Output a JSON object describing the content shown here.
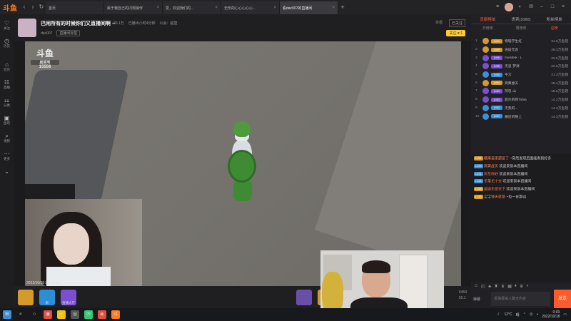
{
  "app": {
    "logo_text": "斗鱼"
  },
  "titlebar": {
    "tabs": [
      {
        "label": "首页"
      },
      {
        "label": "属于我自己的闪现操作"
      },
      {
        "label": "爱，欢迎我们的..."
      },
      {
        "label": "无形的心心心心心..."
      },
      {
        "label": "看dac007的直播间",
        "active": true
      }
    ]
  },
  "leftnav": [
    {
      "icon": "♡",
      "label": "关注"
    },
    {
      "icon": "◷",
      "label": "历史"
    },
    {
      "icon": "⌂",
      "label": "首页"
    },
    {
      "icon": "☷",
      "label": "直播"
    },
    {
      "icon": "⚏",
      "label": "分类"
    },
    {
      "icon": "▣",
      "label": "鱼吧"
    },
    {
      "icon": "⌕",
      "label": "视频"
    },
    {
      "icon": "⋯",
      "label": "更多"
    }
  ],
  "room": {
    "title": "巴闲所有的时候你们又直播间啊 ~",
    "host": "dac007",
    "tag_btn": "直播间标签",
    "hot": "30.1万",
    "stat2": "已播出小时4分钟",
    "stat3": "公会：超皇",
    "report": "举报",
    "mute_btn": "已关注",
    "follow_btn": "关注 ♥ 1"
  },
  "watermark": {
    "logo": "斗鱼",
    "room_label": "房间号",
    "room_no": "15556"
  },
  "cam_left": {
    "timestamp": "2022/10/18 23:10:18"
  },
  "player_bar": {
    "gifts": [
      {
        "label": ""
      },
      {
        "label": "新"
      },
      {
        "label": "直播大厅"
      }
    ],
    "right_line1": "6459",
    "right_line2": "50.1"
  },
  "rightpanel": {
    "tabs": [
      {
        "label": "贡献榜单",
        "active": true
      },
      {
        "label": "贵宾(1060)"
      },
      {
        "label": "粉丝榜单"
      }
    ],
    "subtabs": [
      {
        "label": "日榜单"
      },
      {
        "label": "周榜单"
      },
      {
        "label": "总榜",
        "active": true
      }
    ],
    "ranks": [
      {
        "n": "1",
        "name": "物理学生虹",
        "val": "31.5万鱼翅",
        "lv": "LV41",
        "col": "#d49b2c"
      },
      {
        "n": "2",
        "name": "逍遥无忌",
        "val": "28.3万鱼翅",
        "lv": "LV39",
        "col": "#d49b2c"
      },
      {
        "n": "3",
        "name": "Invisible · L",
        "val": "22.5万鱼翅",
        "lv": "LV38",
        "col": "#7a4fd1"
      },
      {
        "n": "4",
        "name": "无忌·梦清",
        "val": "22.6万鱼翅",
        "lv": "LV35",
        "col": "#7a4fd1"
      },
      {
        "n": "5",
        "name": "牛刀",
        "val": "21.3万鱼翅",
        "lv": "LV35",
        "col": "#3c8fd6"
      },
      {
        "n": "6",
        "name": "冥黄虚天",
        "val": "15.4万鱼翅",
        "lv": "LV34",
        "col": "#d49b2c"
      },
      {
        "n": "7",
        "name": "阿忠·山",
        "val": "15.0万鱼翅",
        "lv": "LV33",
        "col": "#7a4fd1"
      },
      {
        "n": "8",
        "name": "超冰的我Tobia",
        "val": "14.2万鱼翅",
        "lv": "LV33",
        "col": "#7a4fd1"
      },
      {
        "n": "9",
        "name": "无我的...",
        "val": "14.3万鱼翅",
        "lv": "LV32",
        "col": "#3c8fd6"
      },
      {
        "n": "10",
        "name": "最后的晚上",
        "val": "14.3万鱼翅",
        "lv": "LV31",
        "col": "#3c8fd6"
      }
    ],
    "chat": [
      {
        "badge": "LV31",
        "bcol": "#d49b2c",
        "user": "糖果皇家超爱了",
        "text": "~突然发现后面能看到好多"
      },
      {
        "badge": "LV29",
        "bcol": "#3c8fd6",
        "user": "冥黄虚天",
        "text": "欢迎来到本直播间"
      },
      {
        "badge": "LV31",
        "bcol": "#3c8fd6",
        "user": "灰灰你好",
        "text": "欢迎来到本直播间"
      },
      {
        "badge": "LV28",
        "bcol": "#3c8fd6",
        "user": "冬菜尤十夫",
        "text": "欢迎来到本直播间"
      },
      {
        "badge": "LV25",
        "bcol": "#d49b2c",
        "user": "逍遥无忌天下",
        "text": "欢迎来到本直播间"
      },
      {
        "badge": "LV33",
        "bcol": "#d49b2c",
        "user": "宝宝钟天就是",
        "text": "~拉一在那边"
      }
    ],
    "chat_tools": [
      "☺",
      "◰",
      "◈",
      "♜",
      "♛",
      "▦",
      "♦",
      "♛",
      "◐"
    ],
    "input_placeholder": "发弹幕输入聊天内容",
    "input_side": "弹幕",
    "send": "发送"
  },
  "taskbar": {
    "icons": [
      "⊞",
      "⌕",
      "○",
      "◉",
      "◐",
      "◎",
      "✉",
      "◈",
      "斗"
    ],
    "temp": "12°C",
    "weather": "晴",
    "time": "0:03",
    "date": "2022/10/18"
  }
}
